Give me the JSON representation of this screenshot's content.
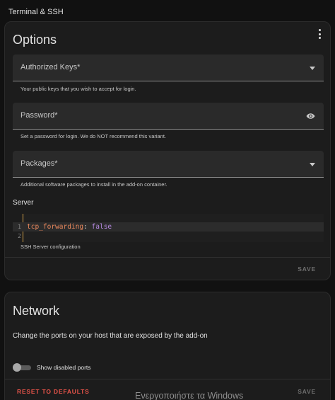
{
  "app": {
    "title": "Terminal & SSH"
  },
  "options": {
    "title": "Options",
    "menu_icon": "kebab-menu-icon",
    "fields": {
      "authorized_keys": {
        "label": "Authorized Keys*",
        "helper": "Your public keys that you wish to accept for login.",
        "icon": "dropdown-arrow-icon"
      },
      "password": {
        "label": "Password*",
        "helper": "Set a password for login. We do NOT recommend this variant.",
        "icon": "eye-icon"
      },
      "packages": {
        "label": "Packages*",
        "helper": "Additional software packages to install in the add-on container.",
        "icon": "dropdown-arrow-icon"
      }
    },
    "server": {
      "label": "Server",
      "code": {
        "lines": [
          {
            "number": "1",
            "key": "tcp_forwarding",
            "separator": ":",
            "value": "false"
          },
          {
            "number": "2",
            "key": "",
            "separator": "",
            "value": ""
          }
        ]
      },
      "helper": "SSH Server configuration"
    },
    "save_label": "SAVE"
  },
  "network": {
    "title": "Network",
    "description": "Change the ports on your host that are exposed by the add-on",
    "toggle": {
      "label": "Show disabled ports",
      "checked": false
    },
    "reset_label": "RESET TO DEFAULTS",
    "save_label": "SAVE"
  },
  "watermark": "Ενεργοποιήστε τα Windows",
  "colors": {
    "background": "#111111",
    "card": "#1c1c1c",
    "field": "#2a2a2a",
    "code_key": "#e8875c",
    "code_value": "#b588e0",
    "gutter_border": "#d4a24a",
    "reset": "#e8544a",
    "disabled_button": "#6f6f6f"
  }
}
